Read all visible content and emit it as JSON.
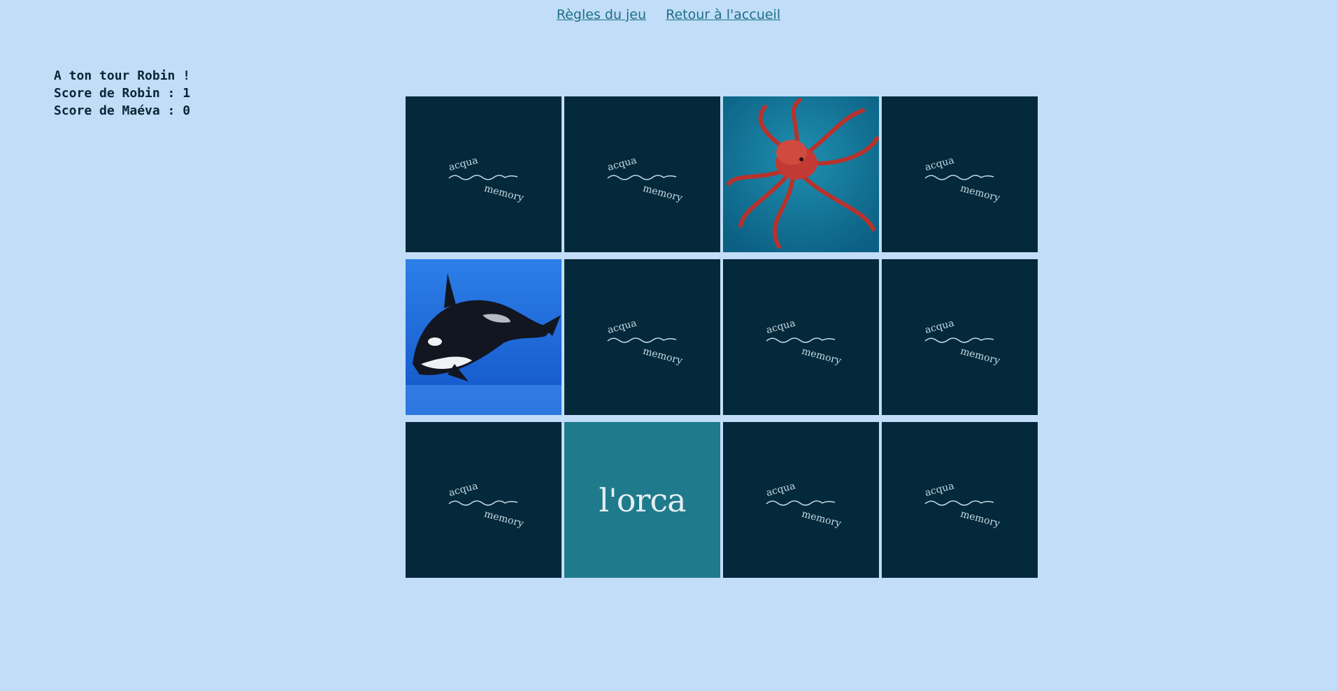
{
  "nav": {
    "rules_link": "Règles du jeu",
    "home_link": "Retour à l'accueil"
  },
  "status": {
    "turn": "A ton tour Robin !",
    "score_player1": "Score de Robin : 1",
    "score_player2": "Score de Maéva : 0"
  },
  "card_back": {
    "logo_top": "acqua",
    "logo_bottom": "memory"
  },
  "cards": [
    {
      "state": "hidden"
    },
    {
      "state": "hidden"
    },
    {
      "state": "revealed",
      "content": "octopus-photo"
    },
    {
      "state": "hidden"
    },
    {
      "state": "revealed",
      "content": "orca-photo"
    },
    {
      "state": "hidden"
    },
    {
      "state": "hidden"
    },
    {
      "state": "hidden"
    },
    {
      "state": "hidden"
    },
    {
      "state": "revealed",
      "content": "name",
      "label": "l'orca"
    },
    {
      "state": "hidden"
    },
    {
      "state": "hidden"
    }
  ],
  "colors": {
    "background": "#c1ddf7",
    "card_back": "#03293a",
    "name_card": "#1f7a8c",
    "link": "#1d6f86",
    "text": "#062737"
  }
}
